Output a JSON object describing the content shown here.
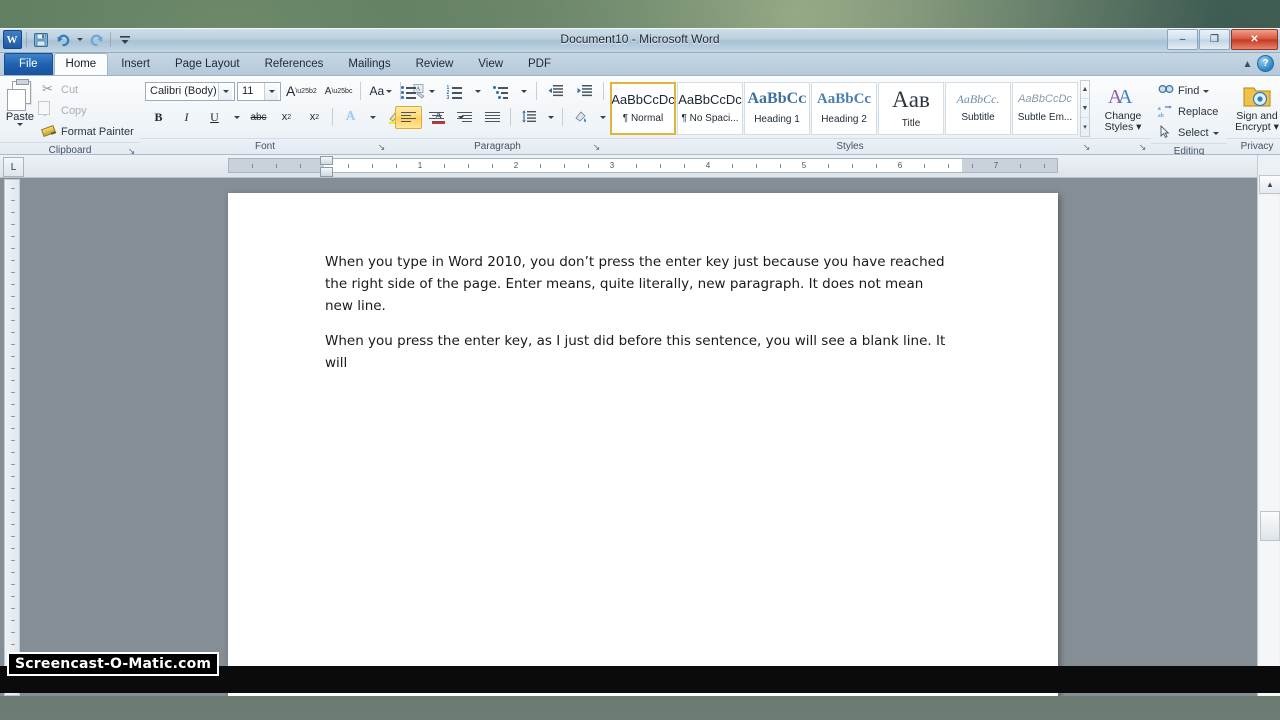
{
  "window": {
    "title": "Document10 - Microsoft Word",
    "controls": {
      "minimize": "–",
      "restore": "❐",
      "close": "✕"
    },
    "help_label": "?",
    "minimize_ribbon_label": "▲"
  },
  "qat": {
    "logo": "W",
    "items": [
      {
        "name": "save-icon",
        "glyph": "💾"
      },
      {
        "name": "undo-icon",
        "glyph": "↶"
      },
      {
        "name": "redo-icon",
        "glyph": "↷"
      },
      {
        "name": "customize-qat-icon",
        "glyph": "▾"
      }
    ]
  },
  "tabs": [
    {
      "label": "File",
      "kind": "file"
    },
    {
      "label": "Home",
      "kind": "active"
    },
    {
      "label": "Insert",
      "kind": "normal"
    },
    {
      "label": "Page Layout",
      "kind": "normal"
    },
    {
      "label": "References",
      "kind": "normal"
    },
    {
      "label": "Mailings",
      "kind": "normal"
    },
    {
      "label": "Review",
      "kind": "normal"
    },
    {
      "label": "View",
      "kind": "normal"
    },
    {
      "label": "PDF",
      "kind": "normal"
    }
  ],
  "ribbon": {
    "clipboard": {
      "label": "Clipboard",
      "paste": "Paste",
      "cut": "Cut",
      "copy": "Copy",
      "format_painter": "Format Painter",
      "dialog_launcher": "↘"
    },
    "font": {
      "label": "Font",
      "font_name": "Calibri (Body)",
      "font_size": "11",
      "grow": "A",
      "shrink": "A",
      "change_case": "Aa",
      "clear_formatting": "⌧",
      "bold": "B",
      "italic": "I",
      "underline": "U",
      "strikethrough": "abc",
      "subscript": "x",
      "superscript": "x",
      "text_effects": "A",
      "highlight": "ab",
      "font_color": "A",
      "dialog_launcher": "↘"
    },
    "paragraph": {
      "label": "Paragraph",
      "bullets": "≡",
      "numbering": "≡",
      "multilevel": "≡",
      "decrease_indent": "⇤",
      "increase_indent": "⇥",
      "sort": "A↓",
      "show_marks": "¶",
      "align_left": "≡",
      "align_center": "≡",
      "align_right": "≡",
      "justify": "≡",
      "line_spacing": "↕",
      "shading": "△",
      "borders": "▦",
      "dialog_launcher": "↘"
    },
    "styles": {
      "label": "Styles",
      "dialog_launcher": "↘",
      "scroll_up": "▲",
      "scroll_down": "▼",
      "more": "▾",
      "items": [
        {
          "preview": "AaBbCcDc",
          "name": "¶ Normal",
          "selected": true,
          "style": "normal"
        },
        {
          "preview": "AaBbCcDc",
          "name": "¶ No Spaci...",
          "selected": false,
          "style": "normal"
        },
        {
          "preview": "AaBbCᴄ",
          "name": "Heading 1",
          "selected": false,
          "style": "heading1"
        },
        {
          "preview": "AaBbCc",
          "name": "Heading 2",
          "selected": false,
          "style": "heading2"
        },
        {
          "preview": "Aав",
          "name": "Title",
          "selected": false,
          "style": "title"
        },
        {
          "preview": "AaBbCc.",
          "name": "Subtitle",
          "selected": false,
          "style": "subtitle"
        },
        {
          "preview": "AaBbCcDᴄ",
          "name": "Subtle Em...",
          "selected": false,
          "style": "subtle"
        }
      ]
    },
    "change_styles": {
      "label_line1": "Change",
      "label_line2": "Styles ▾",
      "icon": "AA"
    },
    "editing": {
      "label": "Editing",
      "find": "Find",
      "replace": "Replace",
      "select": "Select",
      "find_arrow": "▾",
      "select_arrow": "▾"
    },
    "privacy": {
      "label": "Privacy",
      "sign_line1": "Sign and",
      "sign_line2": "Encrypt ▾"
    }
  },
  "ruler": {
    "tab_selector": "L",
    "numbers": [
      "1",
      "2",
      "3",
      "4",
      "5",
      "6",
      "7"
    ],
    "ruler_toggle": "⌗"
  },
  "document": {
    "paragraphs": [
      "When you type in Word 2010, you don’t press the enter key just because you have reached the right side of the page. Enter means, quite literally, new paragraph. It does not mean new line.",
      "When you press the enter key, as I just did before this sentence, you will see a blank line. It will"
    ]
  },
  "scrollbar": {
    "up": "▲",
    "down": "▼"
  },
  "watermark": "Screencast-O-Matic.com",
  "colors": {
    "accent_blue": "#1e5fae",
    "selection_gold": "#e3b23c",
    "close_red": "#c23a21",
    "ribbon_bg": "#f4f7fa"
  }
}
